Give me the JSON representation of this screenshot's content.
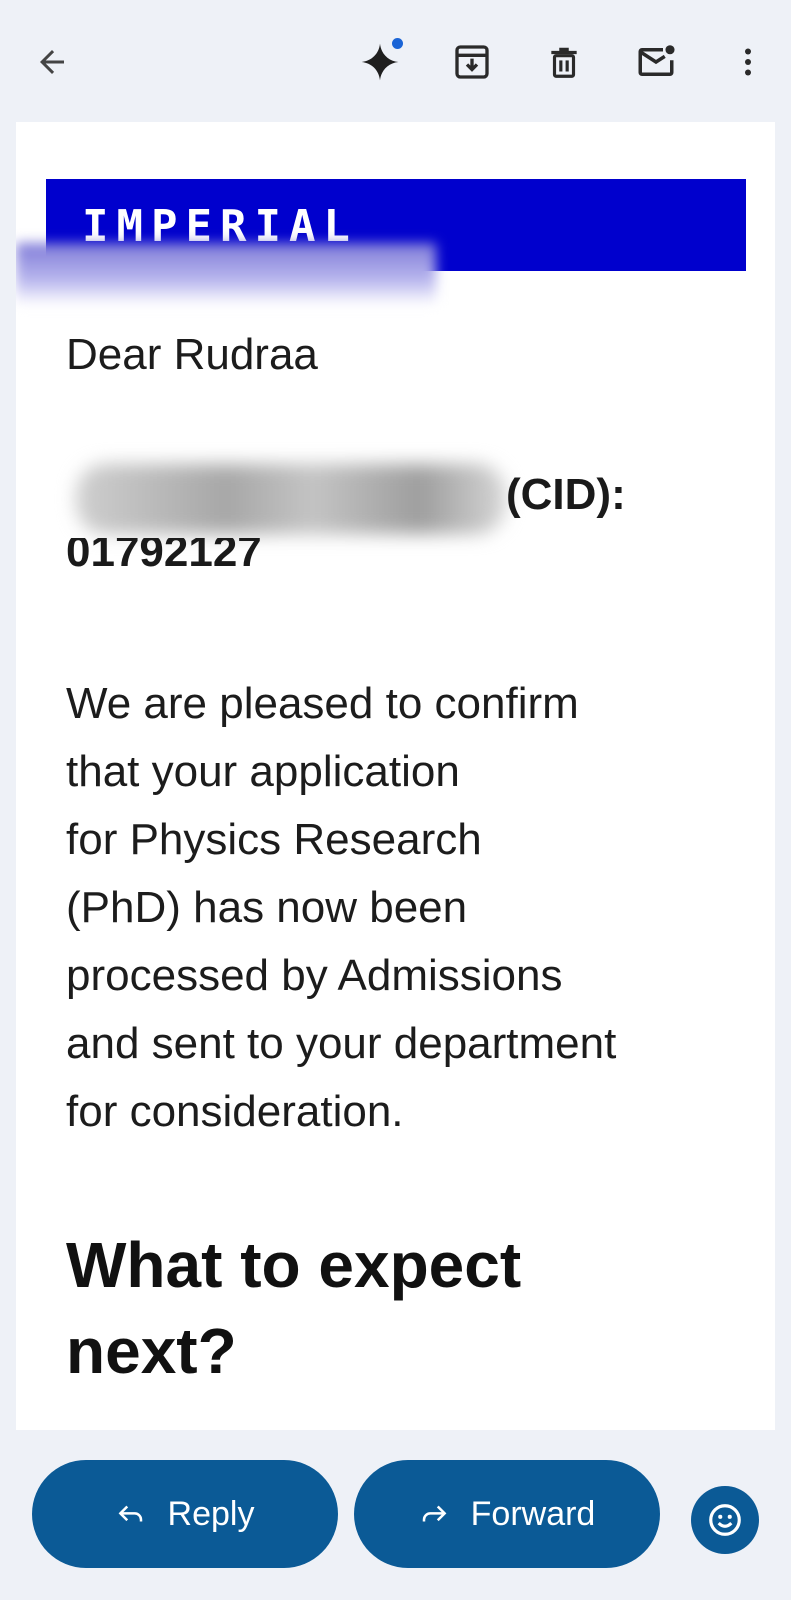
{
  "toolbar": {
    "back_icon": "arrow-left-icon",
    "gemini_icon": "sparkle-icon",
    "archive_icon": "archive-icon",
    "delete_icon": "trash-icon",
    "mark_unread_icon": "mail-unread-icon",
    "more_icon": "more-vertical-icon"
  },
  "email": {
    "banner_text": "IMPERIAL",
    "greeting": "Dear Rudraa",
    "cid_label": "(CID):",
    "cid_value": "01792127",
    "body_lines": [
      "We are pleased to confirm",
      "that your application",
      "for Physics Research",
      "(PhD) has now been",
      "processed by Admissions",
      "and sent to your department",
      "for consideration."
    ],
    "heading_lines": [
      "What to expect",
      "next?"
    ]
  },
  "actions": {
    "reply_label": "Reply",
    "forward_label": "Forward",
    "emoji_icon": "emoji-smile-icon"
  },
  "colors": {
    "banner": "#0000cd",
    "action_button": "#0b5a96",
    "background": "#eef1f7",
    "notification_dot": "#1a64d6"
  }
}
